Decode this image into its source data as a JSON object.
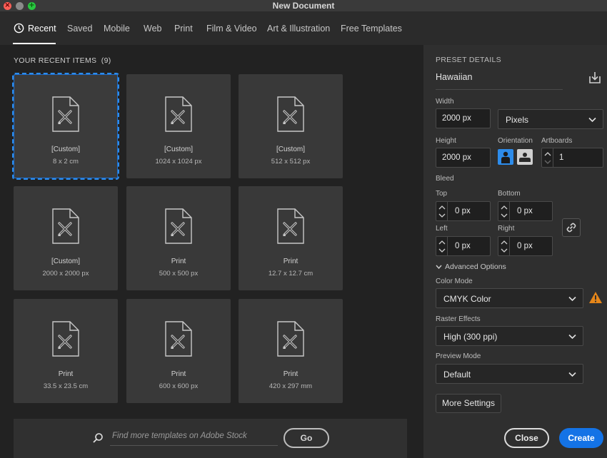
{
  "window": {
    "title": "New Document"
  },
  "tabs": [
    {
      "label": "Recent",
      "active": true
    },
    {
      "label": "Saved"
    },
    {
      "label": "Mobile"
    },
    {
      "label": "Web"
    },
    {
      "label": "Print"
    },
    {
      "label": "Film & Video"
    },
    {
      "label": "Art & Illustration"
    },
    {
      "label": "Free Templates"
    }
  ],
  "recent": {
    "heading": "YOUR RECENT ITEMS",
    "count": "(9)",
    "items": [
      {
        "title": "[Custom]",
        "size": "8 x 2 cm",
        "selected": true
      },
      {
        "title": "[Custom]",
        "size": "1024 x 1024 px"
      },
      {
        "title": "[Custom]",
        "size": "512 x 512 px"
      },
      {
        "title": "[Custom]",
        "size": "2000 x 2000 px"
      },
      {
        "title": "Print",
        "size": "500 x 500 px"
      },
      {
        "title": "Print",
        "size": "12.7 x 12.7 cm"
      },
      {
        "title": "Print",
        "size": "33.5 x 23.5 cm"
      },
      {
        "title": "Print",
        "size": "600 x 600 px"
      },
      {
        "title": "Print",
        "size": "420 x 297 mm"
      }
    ]
  },
  "stock": {
    "placeholder": "Find more templates on Adobe Stock",
    "go_label": "Go"
  },
  "preset": {
    "heading": "PRESET DETAILS",
    "name": "Hawaiian",
    "width_label": "Width",
    "width_value": "2000 px",
    "units_value": "Pixels",
    "height_label": "Height",
    "height_value": "2000 px",
    "orientation_label": "Orientation",
    "artboards_label": "Artboards",
    "artboards_value": "1",
    "bleed_label": "Bleed",
    "top_label": "Top",
    "top_value": "0 px",
    "bottom_label": "Bottom",
    "bottom_value": "0 px",
    "left_label": "Left",
    "left_value": "0 px",
    "right_label": "Right",
    "right_value": "0 px",
    "advanced_label": "Advanced Options",
    "color_mode_label": "Color Mode",
    "color_mode_value": "CMYK Color",
    "raster_label": "Raster Effects",
    "raster_value": "High (300 ppi)",
    "preview_label": "Preview Mode",
    "preview_value": "Default",
    "more_settings_label": "More Settings",
    "close_label": "Close",
    "create_label": "Create"
  },
  "colors": {
    "accent": "#1473e6",
    "selection": "#2d8ceb",
    "warning": "#e68619"
  }
}
